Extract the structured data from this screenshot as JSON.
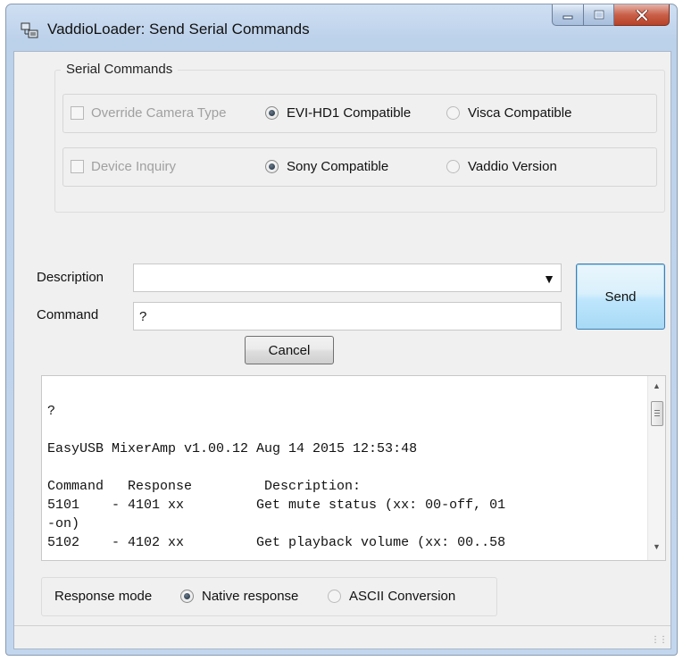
{
  "window": {
    "title": "VaddioLoader: Send Serial Commands",
    "controls": {
      "minimize_icon": "minimize-icon",
      "maximize_icon": "maximize-icon",
      "close_icon": "close-icon"
    }
  },
  "serial_commands": {
    "group_title": "Serial Commands",
    "row1": {
      "override_label": "Override Camera Type",
      "override_checked": false,
      "override_enabled": false,
      "option_a": "EVI-HD1 Compatible",
      "option_b": "Visca Compatible",
      "selected": "EVI-HD1 Compatible"
    },
    "row2": {
      "inquiry_label": "Device Inquiry",
      "inquiry_checked": false,
      "inquiry_enabled": false,
      "option_a": "Sony Compatible",
      "option_b": "Vaddio Version",
      "selected": "Sony Compatible"
    }
  },
  "form": {
    "description_label": "Description",
    "description_value": "",
    "command_label": "Command",
    "command_value": "?",
    "send_label": "Send",
    "cancel_label": "Cancel"
  },
  "output": {
    "lines": [
      "?",
      "",
      "EasyUSB MixerAmp v1.00.12 Aug 14 2015 12:53:48",
      "",
      "Command   Response         Description:",
      "5101    - 4101 xx         Get mute status (xx: 00-off, 01",
      "-on)",
      "5102    - 4102 xx         Get playback volume (xx: 00..58"
    ]
  },
  "response_mode": {
    "label": "Response mode",
    "option_a": "Native response",
    "option_b": "ASCII Conversion",
    "selected": "Native response"
  },
  "colors": {
    "title_bar": "#c2d6ee",
    "close_button": "#c9604a",
    "send_button_border": "#3c7fb1"
  }
}
